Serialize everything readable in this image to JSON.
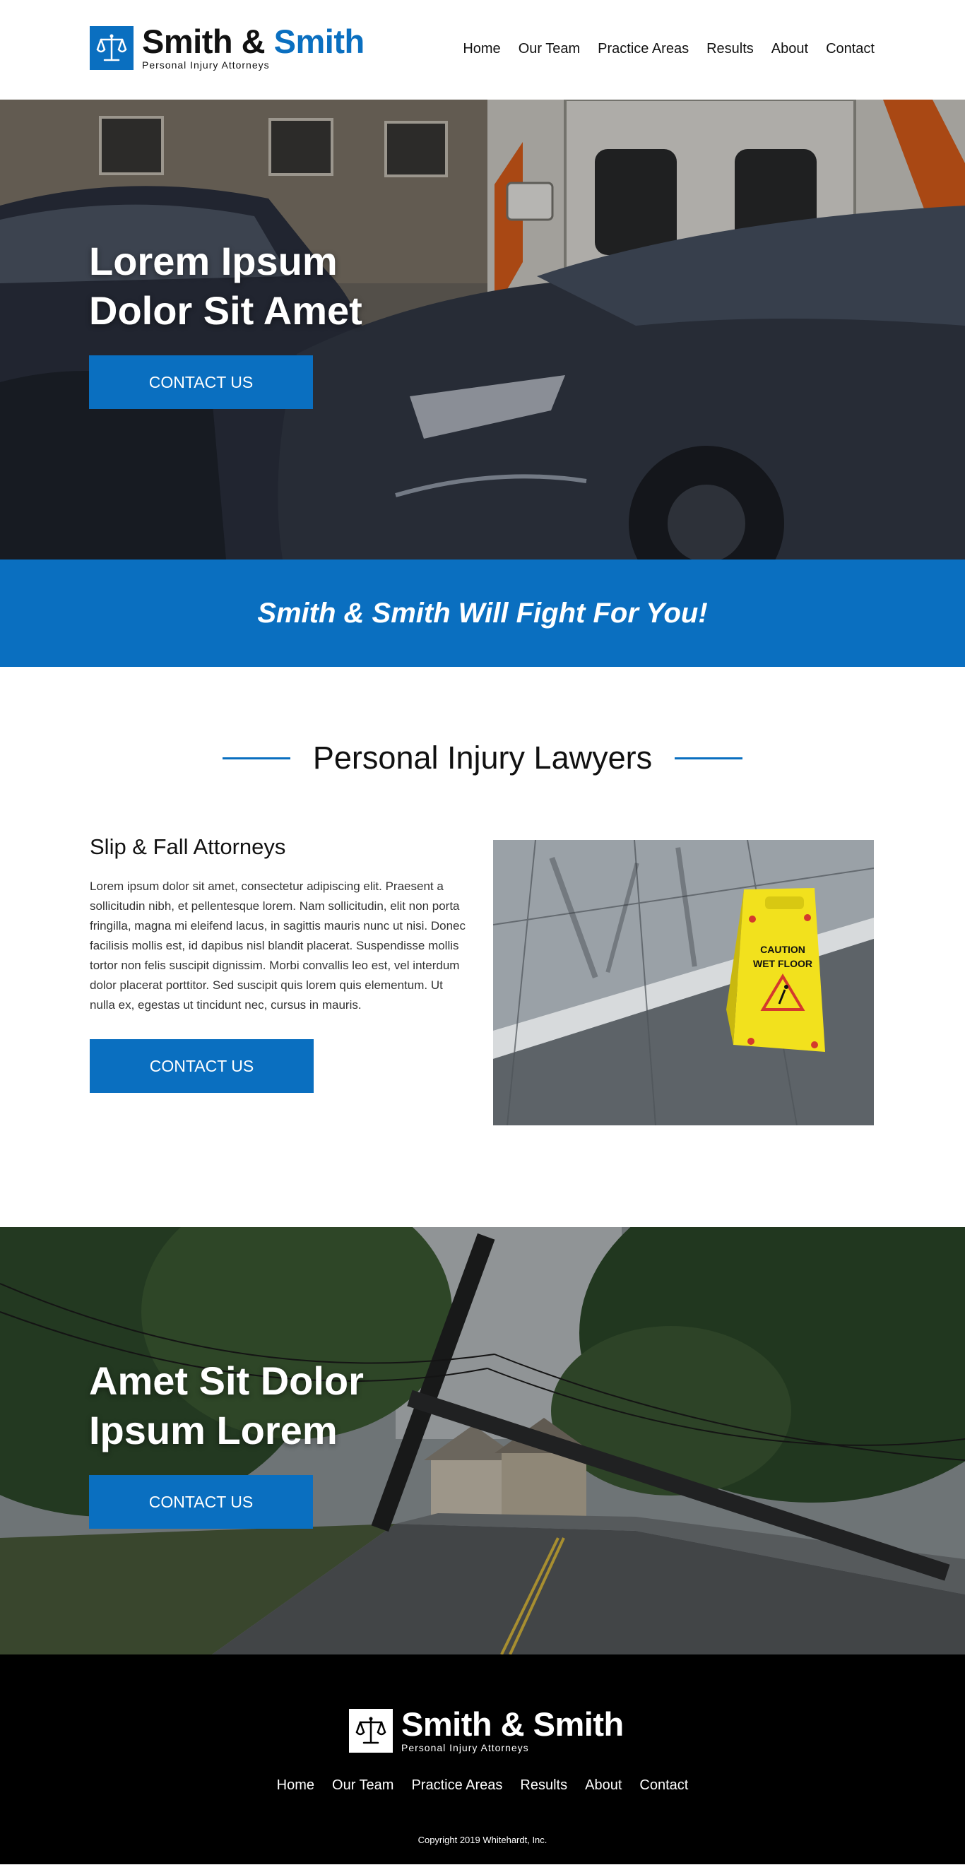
{
  "brand": {
    "name_part1": "Smith &",
    "name_part2": "Smith",
    "name_full": "Smith & Smith",
    "tagline": "Personal Injury Attorneys",
    "accent_color": "#0a6fc0",
    "logo_icon": "scales-of-justice-icon"
  },
  "nav": {
    "items": [
      "Home",
      "Our Team",
      "Practice Areas",
      "Results",
      "About",
      "Contact"
    ]
  },
  "hero1": {
    "title_line1": "Lorem Ipsum",
    "title_line2": "Dolor Sit Amet",
    "button_label": "CONTACT US",
    "image": "car-crash-photo"
  },
  "band": {
    "text": "Smith & Smith Will Fight For You!"
  },
  "section": {
    "title": "Personal Injury Lawyers",
    "article_title": "Slip & Fall Attorneys",
    "article_body": "Lorem ipsum dolor sit amet, consectetur adipiscing elit. Praesent a sollicitudin nibh, et pellentesque lorem. Nam sollicitudin, elit non porta fringilla, magna mi eleifend lacus, in sagittis mauris nunc ut nisi. Donec facilisis mollis est, id dapibus nisl blandit placerat. Suspendisse mollis tortor non felis suscipit dignissim. Morbi convallis leo est, vel interdum dolor placerat porttitor. Sed suscipit quis lorem quis elementum. Ut nulla ex, egestas ut tincidunt nec, cursus in mauris.",
    "button_label": "CONTACT US",
    "sign_line1": "CAUTION",
    "sign_line2": "WET FLOOR",
    "image": "wet-floor-sign-photo"
  },
  "hero2": {
    "title_line1": "Amet Sit Dolor",
    "title_line2": "Ipsum Lorem",
    "button_label": "CONTACT US",
    "image": "fallen-power-pole-photo"
  },
  "footer": {
    "copyright": "Copyright 2019 Whitehardt, Inc."
  }
}
